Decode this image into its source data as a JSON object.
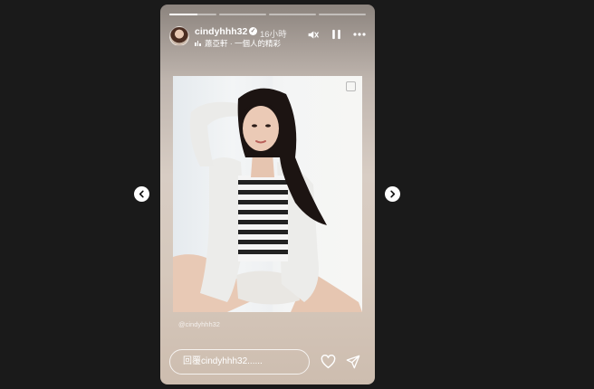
{
  "story": {
    "progress_segments": 4,
    "active_segment": 0,
    "active_fill_percent": 60,
    "username": "cindyhhh32",
    "time_ago": "16小時",
    "music": "蕭亞軒 · 一個人的精彩",
    "watermark": "@cindyhhh32",
    "reply_placeholder": "回覆cindyhhh32......"
  },
  "icons": {
    "mute": "speaker-muted-icon",
    "pause": "pause-icon",
    "more": "more-dots-icon",
    "like": "heart-icon",
    "share": "paper-plane-icon",
    "prev": "chevron-left-icon",
    "next": "chevron-right-icon",
    "verified": "verified-badge-icon",
    "multi": "multi-photo-icon"
  },
  "colors": {
    "page_bg": "#1a1a1a",
    "text": "#ffffff"
  }
}
